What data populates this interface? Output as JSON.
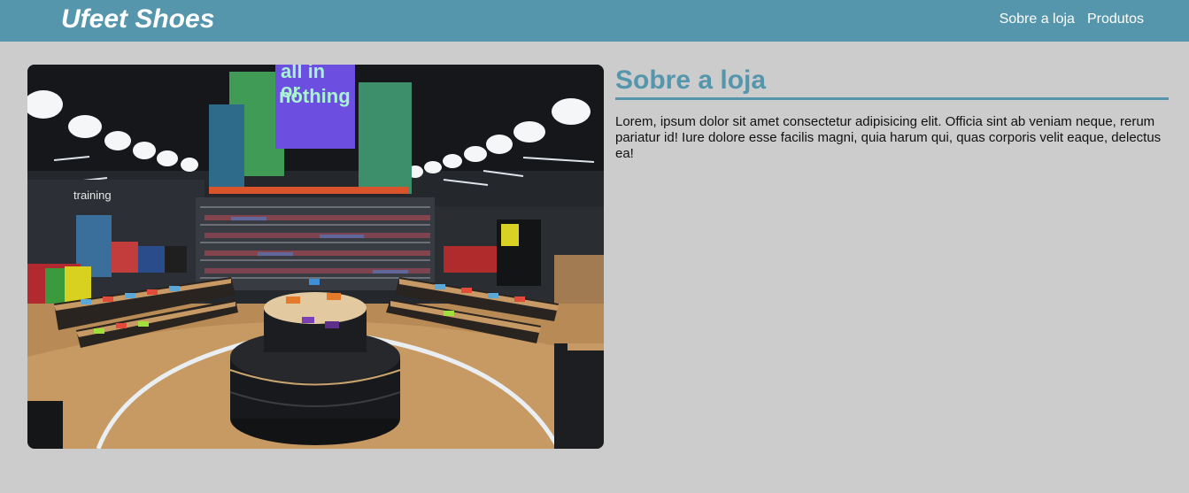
{
  "header": {
    "brand": "Ufeet Shoes",
    "nav": [
      "Sobre a loja",
      "Produtos"
    ]
  },
  "colors": {
    "header_bg": "#5596ad",
    "page_bg": "#cccccc",
    "accent": "#5596ad"
  },
  "photo": {
    "banner_text": [
      "all in",
      "or",
      "nothing"
    ],
    "wall_sign": "training"
  },
  "about": {
    "title": "Sobre a loja",
    "body": "Lorem, ipsum dolor sit amet consectetur adipisicing elit. Officia sint ab veniam neque, rerum pariatur id! Iure dolore esse facilis magni, quia harum qui, quas corporis velit eaque, delectus ea!"
  }
}
